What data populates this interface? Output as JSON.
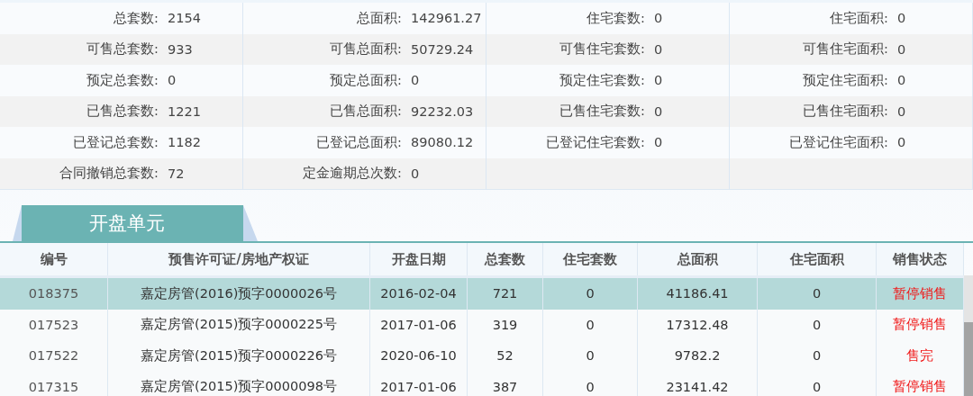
{
  "summary": {
    "rows": [
      [
        {
          "label": "总套数:",
          "value": "2154"
        },
        {
          "label": "总面积:",
          "value": "142961.27"
        },
        {
          "label": "住宅套数:",
          "value": "0"
        },
        {
          "label": "住宅面积:",
          "value": "0"
        }
      ],
      [
        {
          "label": "可售总套数:",
          "value": "933"
        },
        {
          "label": "可售总面积:",
          "value": "50729.24"
        },
        {
          "label": "可售住宅套数:",
          "value": "0"
        },
        {
          "label": "可售住宅面积:",
          "value": "0"
        }
      ],
      [
        {
          "label": "预定总套数:",
          "value": "0"
        },
        {
          "label": "预定总面积:",
          "value": "0"
        },
        {
          "label": "预定住宅套数:",
          "value": "0"
        },
        {
          "label": "预定住宅面积:",
          "value": "0"
        }
      ],
      [
        {
          "label": "已售总套数:",
          "value": "1221"
        },
        {
          "label": "已售总面积:",
          "value": "92232.03"
        },
        {
          "label": "已售住宅套数:",
          "value": "0"
        },
        {
          "label": "已售住宅面积:",
          "value": "0"
        }
      ],
      [
        {
          "label": "已登记总套数:",
          "value": "1182"
        },
        {
          "label": "已登记总面积:",
          "value": "89080.12"
        },
        {
          "label": "已登记住宅套数:",
          "value": "0"
        },
        {
          "label": "已登记住宅面积:",
          "value": "0"
        }
      ],
      [
        {
          "label": "合同撤销总套数:",
          "value": "72"
        },
        {
          "label": "定金逾期总次数:",
          "value": "0"
        }
      ]
    ]
  },
  "section_tab": {
    "label": "开盘单元"
  },
  "table": {
    "columns": [
      "编号",
      "预售许可证/房地产权证",
      "开盘日期",
      "总套数",
      "住宅套数",
      "总面积",
      "住宅面积",
      "销售状态"
    ],
    "rows": [
      {
        "selected": true,
        "cells": [
          "018375",
          "嘉定房管(2016)预字0000026号",
          "2016-02-04",
          "721",
          "0",
          "41186.41",
          "0",
          "暂停销售"
        ]
      },
      {
        "selected": false,
        "cells": [
          "017523",
          "嘉定房管(2015)预字0000225号",
          "2017-01-06",
          "319",
          "0",
          "17312.48",
          "0",
          "暂停销售"
        ]
      },
      {
        "selected": false,
        "cells": [
          "017522",
          "嘉定房管(2015)预字0000226号",
          "2020-06-10",
          "52",
          "0",
          "9782.2",
          "0",
          "售完"
        ]
      },
      {
        "selected": false,
        "cells": [
          "017315",
          "嘉定房管(2015)预字0000098号",
          "2017-01-06",
          "387",
          "0",
          "23141.42",
          "0",
          "暂停销售"
        ]
      }
    ]
  }
}
